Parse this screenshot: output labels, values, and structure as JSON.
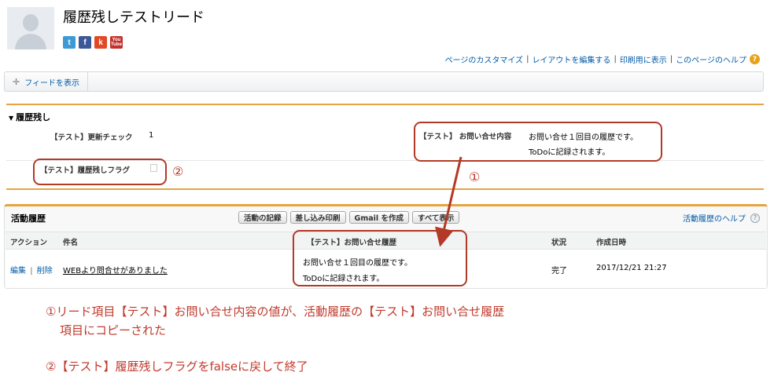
{
  "record": {
    "title": "履歴残しテストリード",
    "social_icons": [
      {
        "name": "twitter-icon",
        "glyph": "t",
        "color": "#3d9ad6"
      },
      {
        "name": "facebook-icon",
        "glyph": "f",
        "color": "#3b5998"
      },
      {
        "name": "klout-icon",
        "glyph": "k",
        "color": "#e24a25"
      },
      {
        "name": "youtube-icon",
        "glyph": "You\nTube",
        "color": "#c4302b"
      }
    ]
  },
  "top_links": {
    "customize": "ページのカスタマイズ",
    "edit_layout": "レイアウトを編集する",
    "print_view": "印刷用に表示",
    "help": "このページのヘルプ",
    "sep": "|",
    "help_glyph": "?"
  },
  "feed": {
    "show_feed": "フィードを表示"
  },
  "section": {
    "title": "履歴残し",
    "fields": {
      "update_check_label": "【テスト】更新チェック",
      "update_check_value": "1",
      "inquiry_label": "【テスト】 お問い合せ内容",
      "inquiry_value_line1": "お問い合せ１回目の履歴です。",
      "inquiry_value_line2": "ToDoに記録されます。",
      "keep_flag_label": "【テスト】履歴残しフラグ"
    }
  },
  "annotations": {
    "marker1": "①",
    "marker2": "②",
    "note1_line1": "①リード項目【テスト】お問い合せ内容の値が、活動履歴の【テスト】お問い合せ履歴",
    "note1_line2": "項目にコピーされた",
    "note2": "②【テスト】履歴残しフラグをfalseに戻して終了"
  },
  "activity_history": {
    "title": "活動履歴",
    "buttons": {
      "log_activity": "活動の記録",
      "mail_merge": "差し込み印刷",
      "compose_gmail": "Gmail を作成",
      "view_all": "すべて表示"
    },
    "help": "活動履歴のヘルプ",
    "help_glyph": "?",
    "columns": {
      "action": "アクション",
      "subject": "件名",
      "inquiry_history": "【テスト】お問い合せ履歴",
      "status": "状況",
      "created": "作成日時"
    },
    "row": {
      "edit": "編集",
      "action_sep": "|",
      "delete": "削除",
      "subject": "WEBより問合せがありました",
      "inquiry_line1": "お問い合せ１回目の履歴です。",
      "inquiry_line2": "ToDoに記録されます。",
      "status": "完了",
      "created": "2017/12/21 21:27"
    }
  },
  "colors": {
    "accent_orange": "#e5a440",
    "link_blue": "#015ba7",
    "annotation_red": "#c0392b"
  }
}
